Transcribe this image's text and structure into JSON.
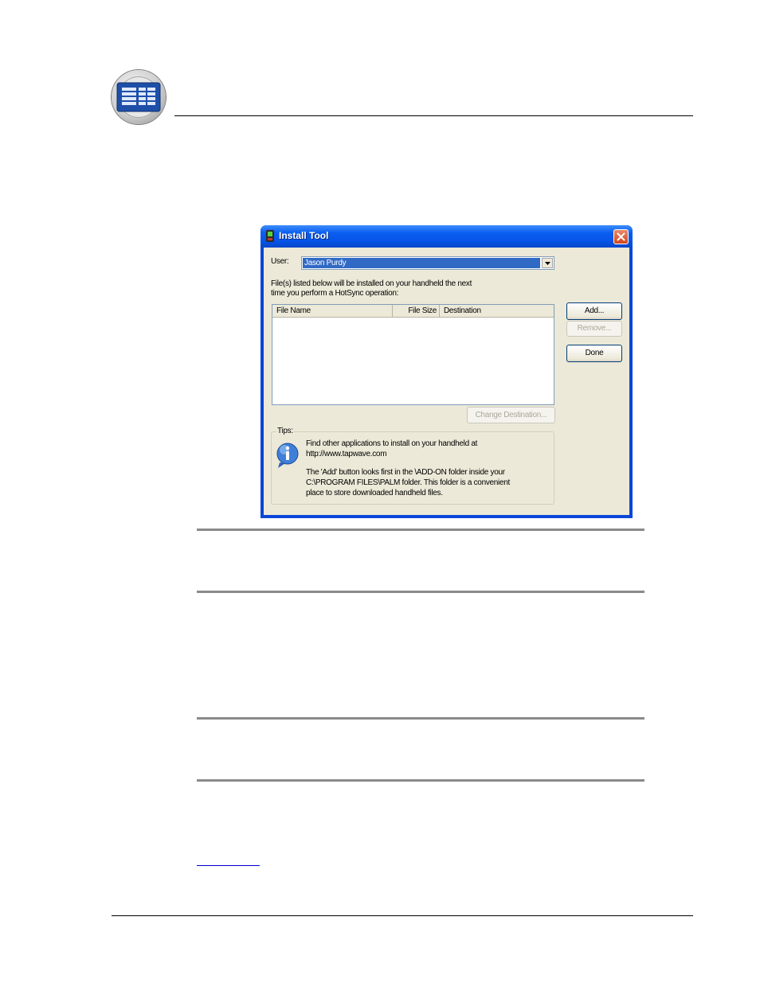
{
  "dialog": {
    "title": "Install Tool",
    "user_label": "User:",
    "user_value": "Jason Purdy",
    "info_line1": "File(s) listed below will be installed on your handheld the next",
    "info_line2": "time you perform a HotSync operation:",
    "columns": [
      "File Name",
      "File Size",
      "Destination"
    ],
    "buttons": {
      "add": "Add...",
      "remove": "Remove...",
      "done": "Done",
      "change_destination": "Change Destination..."
    },
    "tips": {
      "label": "Tips:",
      "line1": "Find other applications to install on your handheld at",
      "line2": "http://www.tapwave.com",
      "line3": "The 'Add' button looks first in the \\ADD-ON folder inside your",
      "line4": "C:\\PROGRAM FILES\\PALM folder. This folder is a convenient",
      "line5": "place to store downloaded handheld files."
    }
  },
  "colors": {
    "titlebar": "#0a5ef0",
    "dialog_face": "#ece9d8",
    "selection": "#316ac5",
    "close_button": "#d3461c",
    "rule": "#8a8a8a"
  },
  "icons": [
    "book-toc-icon",
    "app-icon",
    "close-icon",
    "dropdown-arrow-icon",
    "info-icon"
  ]
}
